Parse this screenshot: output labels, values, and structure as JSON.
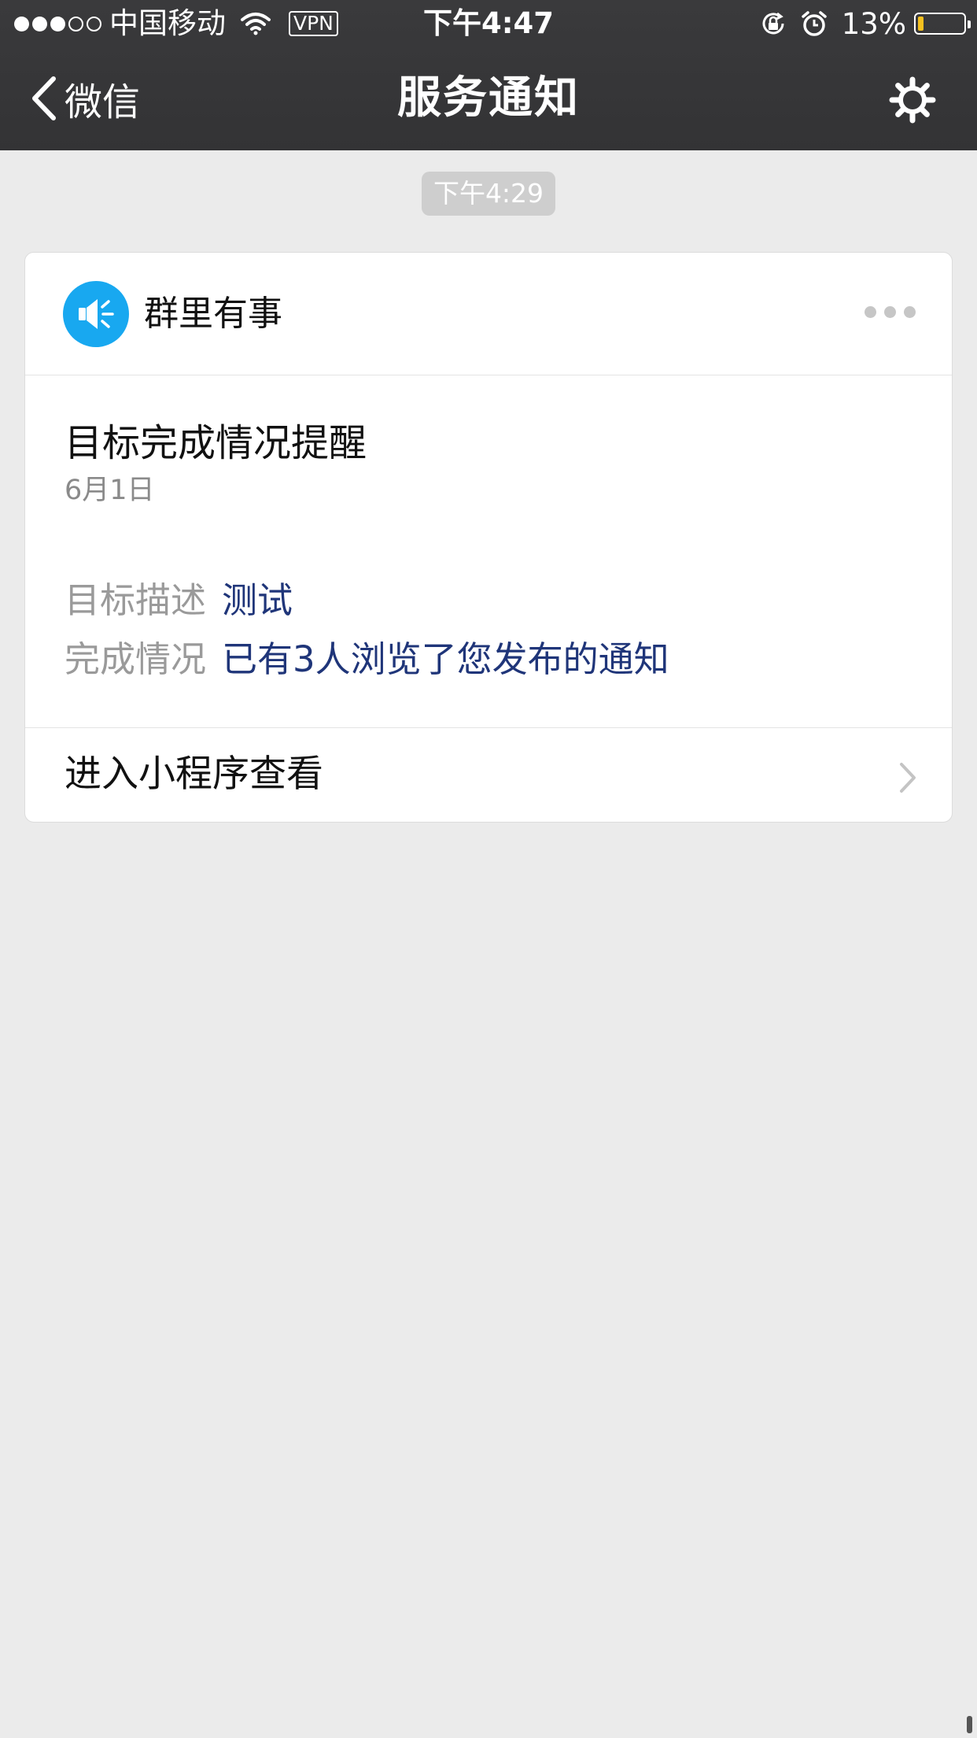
{
  "status_bar": {
    "signal_dots_full": 3,
    "signal_dots_total": 5,
    "carrier": "中国移动",
    "vpn": "VPN",
    "time": "下午4:47",
    "battery_percent": "13%",
    "battery_level": 0.13,
    "icons": [
      "wifi-icon",
      "rotation-lock-icon",
      "alarm-icon",
      "battery-icon"
    ]
  },
  "nav": {
    "back_label": "微信",
    "title": "服务通知",
    "right_icon": "gear-icon"
  },
  "timestamp": "下午4:29",
  "card": {
    "app_name": "群里有事",
    "app_icon": "speaker-icon",
    "more_icon": "more-dots-icon",
    "title": "目标完成情况提醒",
    "date": "6月1日",
    "fields": [
      {
        "label": "目标描述",
        "value": "测试"
      },
      {
        "label": "完成情况",
        "value": "已有3人浏览了您发布的通知"
      }
    ],
    "action_label": "进入小程序查看",
    "action_icon": "chevron-right-icon"
  },
  "colors": {
    "topbar": "#363638",
    "background": "#ebebeb",
    "app_icon": "#18a8f0",
    "field_value": "#1f3579",
    "battery_fill": "#f5c01f"
  }
}
